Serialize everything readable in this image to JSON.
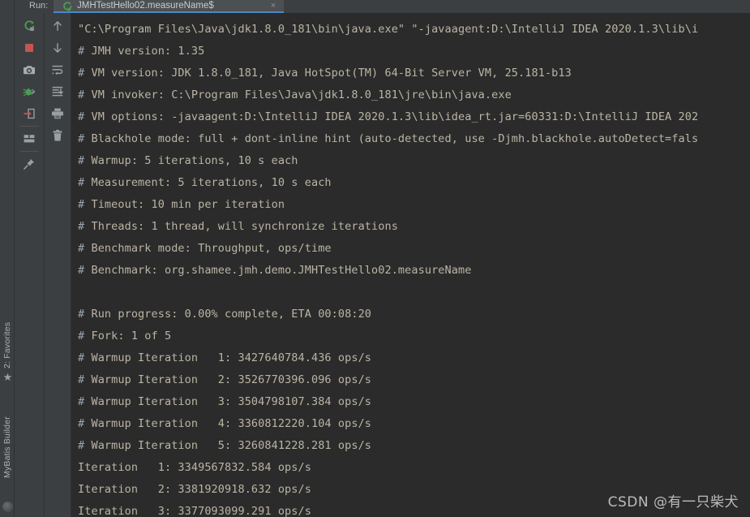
{
  "window": {
    "run_label": "Run:",
    "tab_title": "JMHTestHello02.measureName$",
    "close_glyph": "×",
    "accent_color": "#4A88C7",
    "background_color": "#2B2B2B",
    "panel_color": "#3C3F41",
    "text_color": "#BBB5A5"
  },
  "left_strip": {
    "tabs": [
      {
        "label": "2: Favorites",
        "icon": "star-icon"
      },
      {
        "label": "MyBatis Builder",
        "icon": ""
      }
    ],
    "star_glyph": "★"
  },
  "toolbar_primary": [
    {
      "name": "rerun-button",
      "title": "Rerun"
    },
    {
      "name": "stop-button",
      "title": "Stop"
    },
    {
      "name": "screenshot-button",
      "title": "Screenshot"
    },
    {
      "name": "debug-button",
      "title": "Debug"
    },
    {
      "name": "exit-button",
      "title": "Exit"
    },
    {
      "name": "layout-button",
      "title": "Layout"
    },
    {
      "name": "pin-button",
      "title": "Pin Tab"
    }
  ],
  "toolbar_secondary": [
    {
      "name": "up-button",
      "title": "Up"
    },
    {
      "name": "down-button",
      "title": "Down"
    },
    {
      "name": "soft-wrap-button",
      "title": "Soft-Wrap"
    },
    {
      "name": "scroll-end-button",
      "title": "Scroll to End"
    },
    {
      "name": "print-button",
      "title": "Print"
    },
    {
      "name": "clear-button",
      "title": "Clear All"
    }
  ],
  "console": {
    "lines": [
      {
        "hash": "",
        "text": "\"C:\\Program Files\\Java\\jdk1.8.0_181\\bin\\java.exe\" \"-javaagent:D:\\IntelliJ IDEA 2020.1.3\\lib\\i"
      },
      {
        "hash": "#",
        "text": " JMH version: 1.35"
      },
      {
        "hash": "#",
        "text": " VM version: JDK 1.8.0_181, Java HotSpot(TM) 64-Bit Server VM, 25.181-b13"
      },
      {
        "hash": "#",
        "text": " VM invoker: C:\\Program Files\\Java\\jdk1.8.0_181\\jre\\bin\\java.exe"
      },
      {
        "hash": "#",
        "text": " VM options: -javaagent:D:\\IntelliJ IDEA 2020.1.3\\lib\\idea_rt.jar=60331:D:\\IntelliJ IDEA 202"
      },
      {
        "hash": "#",
        "text": " Blackhole mode: full + dont-inline hint (auto-detected, use -Djmh.blackhole.autoDetect=fals"
      },
      {
        "hash": "#",
        "text": " Warmup: 5 iterations, 10 s each"
      },
      {
        "hash": "#",
        "text": " Measurement: 5 iterations, 10 s each"
      },
      {
        "hash": "#",
        "text": " Timeout: 10 min per iteration"
      },
      {
        "hash": "#",
        "text": " Threads: 1 thread, will synchronize iterations"
      },
      {
        "hash": "#",
        "text": " Benchmark mode: Throughput, ops/time"
      },
      {
        "hash": "#",
        "text": " Benchmark: org.shamee.jmh.demo.JMHTestHello02.measureName"
      },
      {
        "hash": "",
        "text": ""
      },
      {
        "hash": "#",
        "text": " Run progress: 0.00% complete, ETA 00:08:20"
      },
      {
        "hash": "#",
        "text": " Fork: 1 of 5"
      },
      {
        "hash": "#",
        "text": " Warmup Iteration   1: 3427640784.436 ops/s"
      },
      {
        "hash": "#",
        "text": " Warmup Iteration   2: 3526770396.096 ops/s"
      },
      {
        "hash": "#",
        "text": " Warmup Iteration   3: 3504798107.384 ops/s"
      },
      {
        "hash": "#",
        "text": " Warmup Iteration   4: 3360812220.104 ops/s"
      },
      {
        "hash": "#",
        "text": " Warmup Iteration   5: 3260841228.281 ops/s"
      },
      {
        "hash": "",
        "text": "Iteration   1: 3349567832.584 ops/s"
      },
      {
        "hash": "",
        "text": "Iteration   2: 3381920918.632 ops/s"
      },
      {
        "hash": "",
        "text": "Iteration   3: 3377093099.291 ops/s"
      }
    ]
  },
  "watermark": {
    "text": "CSDN @有一只柴犬"
  }
}
